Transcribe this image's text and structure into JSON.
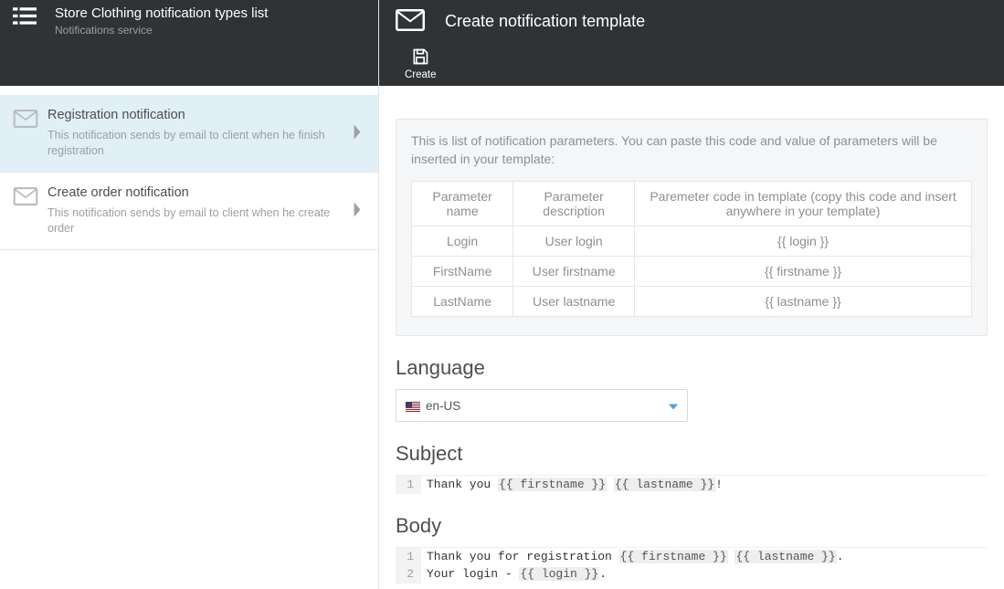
{
  "sidebar": {
    "title": "Store Clothing notification types list",
    "subtitle": "Notifications service",
    "items": [
      {
        "title": "Registration notification",
        "desc": "This notification sends by email to client when he finish registration",
        "selected": true
      },
      {
        "title": "Create order notification",
        "desc": "This notification sends by email to client when he create order",
        "selected": false
      }
    ]
  },
  "main": {
    "title": "Create notification template",
    "toolbar": {
      "create_label": "Create"
    },
    "info": {
      "text": "This is list of notification parameters. You can paste this code and value of parameters will be inserted in your template:",
      "columns": {
        "name": "Parameter name",
        "desc": "Parameter description",
        "code": "Paremeter code in template (copy this code and insert anywhere in your template)"
      },
      "rows": [
        {
          "name": "Login",
          "desc": "User login",
          "code": "{{ login }}"
        },
        {
          "name": "FirstName",
          "desc": "User firstname",
          "code": "{{ firstname }}"
        },
        {
          "name": "LastName",
          "desc": "User lastname",
          "code": "{{ lastname }}"
        }
      ]
    },
    "language": {
      "heading": "Language",
      "value": "en-US"
    },
    "subject": {
      "heading": "Subject",
      "lines": [
        [
          {
            "t": "text",
            "v": "Thank you "
          },
          {
            "t": "var",
            "v": "{{ firstname }}"
          },
          {
            "t": "text",
            "v": " "
          },
          {
            "t": "var",
            "v": "{{ lastname }}"
          },
          {
            "t": "text",
            "v": "!"
          }
        ]
      ]
    },
    "body": {
      "heading": "Body",
      "lines": [
        [
          {
            "t": "text",
            "v": "Thank you for registration "
          },
          {
            "t": "var",
            "v": "{{ firstname }}"
          },
          {
            "t": "text",
            "v": " "
          },
          {
            "t": "var",
            "v": "{{ lastname }}"
          },
          {
            "t": "text",
            "v": "."
          }
        ],
        [
          {
            "t": "text",
            "v": "Your login - "
          },
          {
            "t": "var",
            "v": "{{ login }}"
          },
          {
            "t": "text",
            "v": "."
          }
        ]
      ]
    }
  }
}
